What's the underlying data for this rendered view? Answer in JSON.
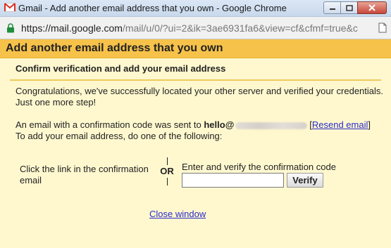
{
  "window": {
    "title": "Gmail - Add another email address that you own - Google Chrome"
  },
  "address_bar": {
    "url_host": "https://mail.google.com",
    "url_path": "/mail/u/0/?ui=2&ik=3ae6931fa6&view=cf&cfmf=true&c"
  },
  "dialog": {
    "title": "Add another email address that you own",
    "section_title": "Confirm verification and add your email address",
    "congrats_line1": "Congratulations, we've successfully located your other server and verified your credentials.",
    "congrats_line2": "Just one more step!",
    "sent_prefix": "An email with a confirmation code was sent to ",
    "sent_email": "hello@",
    "resend_label": "Resend email",
    "instruction": "To add your email address, do one of the following:",
    "option_link_text": "Click the link in the confirmation email",
    "or_label": "OR",
    "option_code_label": "Enter and verify the confirmation code",
    "code_value": "",
    "verify_label": "Verify",
    "close_label": "Close window"
  },
  "colors": {
    "header_bg": "#f6c24a",
    "dialog_bg": "#fff8cf",
    "link": "#2a2ac9"
  },
  "icons": [
    "gmail-icon",
    "minimize-icon",
    "maximize-icon",
    "close-icon",
    "lock-icon",
    "page-icon"
  ]
}
